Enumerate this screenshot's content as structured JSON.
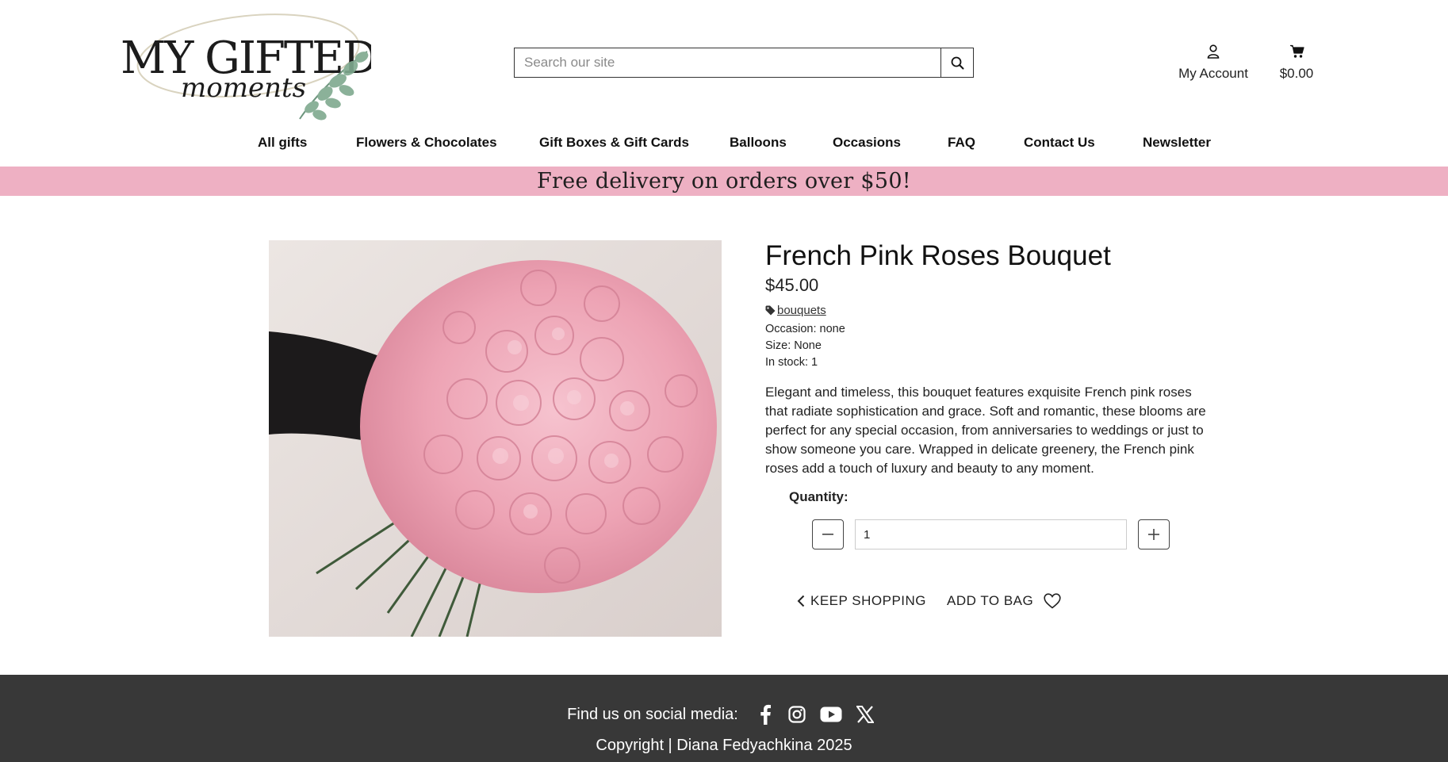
{
  "header": {
    "logo": {
      "line1": "MY GIFTED",
      "line2": "moments"
    },
    "search": {
      "placeholder": "Search our site",
      "value": ""
    },
    "account_label": "My Account",
    "cart_total": "$0.00"
  },
  "nav": {
    "items": [
      {
        "label": "All gifts"
      },
      {
        "label": "Flowers & Chocolates"
      },
      {
        "label": "Gift Boxes & Gift Cards"
      },
      {
        "label": "Balloons"
      },
      {
        "label": "Occasions"
      },
      {
        "label": "FAQ"
      },
      {
        "label": "Contact Us"
      },
      {
        "label": "Newsletter"
      }
    ]
  },
  "promo": {
    "text": "Free delivery on orders over $50!"
  },
  "product": {
    "title": "French Pink Roses Bouquet",
    "price": "$45.00",
    "tag": "bouquets",
    "occasion": "Occasion: none",
    "size": "Size: None",
    "stock": "In stock: 1",
    "description": "Elegant and timeless, this bouquet features exquisite French pink roses that radiate sophistication and grace. Soft and romantic, these blooms are perfect for any special occasion, from anniversaries to weddings or just to show someone you care. Wrapped in delicate greenery, the French pink roses add a touch of luxury and beauty to any moment.",
    "quantity_label": "Quantity:",
    "quantity_value": "1",
    "keep_shopping": "KEEP SHOPPING",
    "add_to_bag": "ADD TO BAG"
  },
  "footer": {
    "social_label": "Find us on social media:",
    "social_icons": [
      "facebook-icon",
      "instagram-icon",
      "youtube-icon",
      "x-icon"
    ],
    "copyright": "Copyright | Diana Fedyachkina 2025"
  },
  "colors": {
    "promo_bg": "#eeb0c3",
    "footer_bg": "#383838",
    "rose_pink": "#f0a9b9"
  }
}
